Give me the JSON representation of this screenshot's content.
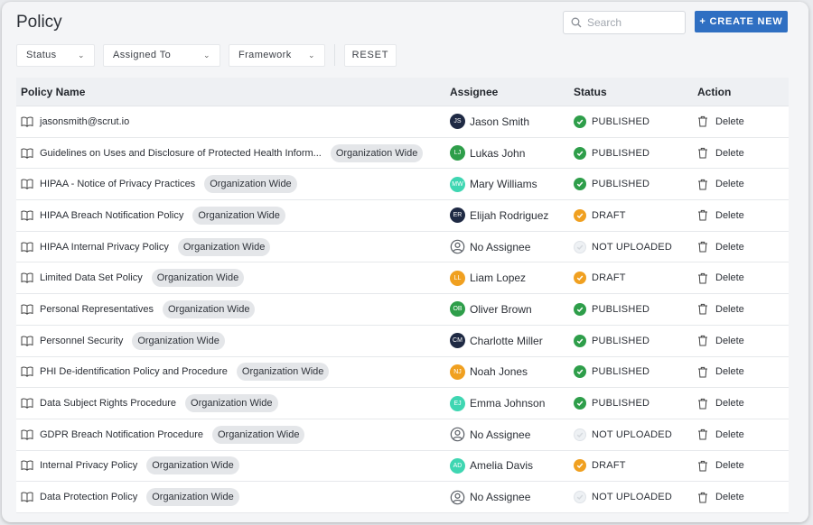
{
  "page": {
    "title": "Policy"
  },
  "search": {
    "placeholder": "Search"
  },
  "toolbar": {
    "create_label": "+ CREATE NEW",
    "reset_label": "RESET"
  },
  "filters": [
    {
      "label": "Status"
    },
    {
      "label": "Assigned To"
    },
    {
      "label": "Framework"
    }
  ],
  "table": {
    "headers": {
      "name": "Policy Name",
      "assignee": "Assignee",
      "status": "Status",
      "action": "Action"
    },
    "rows": [
      {
        "name": "jasonsmith@scrut.io",
        "tag": "",
        "assignee": "Jason Smith",
        "initials": "JS",
        "avatar_color": "#1f2a44",
        "status": "PUBLISHED",
        "status_type": "published",
        "action": "Delete"
      },
      {
        "name": "Guidelines on Uses and Disclosure of Protected Health Inform...",
        "tag": "Organization Wide",
        "assignee": "Lukas John",
        "initials": "LJ",
        "avatar_color": "#2e9e4a",
        "status": "PUBLISHED",
        "status_type": "published",
        "action": "Delete"
      },
      {
        "name": "HIPAA - Notice of Privacy Practices",
        "tag": "Organization Wide",
        "assignee": "Mary Williams",
        "initials": "MW",
        "avatar_color": "#3fd6b2",
        "status": "PUBLISHED",
        "status_type": "published",
        "action": "Delete"
      },
      {
        "name": "HIPAA Breach Notification Policy",
        "tag": "Organization Wide",
        "assignee": "Elijah Rodriguez",
        "initials": "ER",
        "avatar_color": "#1f2a44",
        "status": "DRAFT",
        "status_type": "draft",
        "action": "Delete"
      },
      {
        "name": "HIPAA Internal Privacy Policy",
        "tag": "Organization Wide",
        "assignee": "No Assignee",
        "initials": "",
        "avatar_color": "",
        "status": "NOT UPLOADED",
        "status_type": "not-uploaded",
        "action": "Delete"
      },
      {
        "name": "Limited Data Set Policy",
        "tag": "Organization Wide",
        "assignee": "Liam Lopez",
        "initials": "LL",
        "avatar_color": "#f0a020",
        "status": "DRAFT",
        "status_type": "draft",
        "action": "Delete"
      },
      {
        "name": "Personal Representatives",
        "tag": "Organization Wide",
        "assignee": "Oliver Brown",
        "initials": "OB",
        "avatar_color": "#2e9e4a",
        "status": "PUBLISHED",
        "status_type": "published",
        "action": "Delete"
      },
      {
        "name": "Personnel Security",
        "tag": "Organization Wide",
        "assignee": "Charlotte Miller",
        "initials": "CM",
        "avatar_color": "#1f2a44",
        "status": "PUBLISHED",
        "status_type": "published",
        "action": "Delete"
      },
      {
        "name": "PHI De-identification Policy and Procedure",
        "tag": "Organization Wide",
        "assignee": "Noah Jones",
        "initials": "NJ",
        "avatar_color": "#f0a020",
        "status": "PUBLISHED",
        "status_type": "published",
        "action": "Delete"
      },
      {
        "name": "Data Subject Rights Procedure",
        "tag": "Organization Wide",
        "assignee": "Emma Johnson",
        "initials": "EJ",
        "avatar_color": "#3fd6b2",
        "status": "PUBLISHED",
        "status_type": "published",
        "action": "Delete"
      },
      {
        "name": "GDPR Breach Notification Procedure",
        "tag": "Organization Wide",
        "assignee": "No Assignee",
        "initials": "",
        "avatar_color": "",
        "status": "NOT UPLOADED",
        "status_type": "not-uploaded",
        "action": "Delete"
      },
      {
        "name": "Internal Privacy Policy",
        "tag": "Organization Wide",
        "assignee": "Amelia Davis",
        "initials": "AD",
        "avatar_color": "#3fd6b2",
        "status": "DRAFT",
        "status_type": "draft",
        "action": "Delete"
      },
      {
        "name": "Data Protection Policy",
        "tag": "Organization Wide",
        "assignee": "No Assignee",
        "initials": "",
        "avatar_color": "",
        "status": "NOT UPLOADED",
        "status_type": "not-uploaded",
        "action": "Delete"
      }
    ]
  },
  "colors": {
    "primary": "#2f6fc2",
    "published": "#2e9e4a",
    "draft": "#f0a020",
    "not_uploaded": "#dfe3e8"
  }
}
